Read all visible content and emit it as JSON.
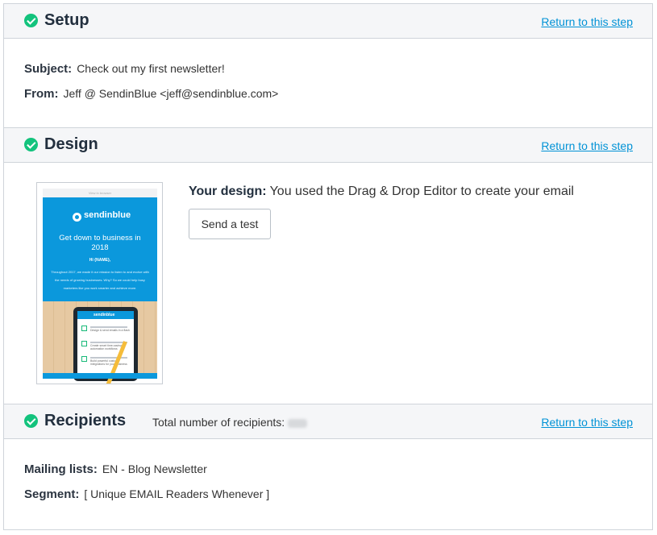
{
  "setup": {
    "title": "Setup",
    "return_link": "Return to this step",
    "subject_label": "Subject:",
    "subject_value": "Check out my first newsletter!",
    "from_label": "From:",
    "from_value": "Jeff @ SendinBlue <jeff@sendinblue.com>"
  },
  "design": {
    "title": "Design",
    "return_link": "Return to this step",
    "label": "Your design:",
    "description": "You used the Drag & Drop Editor to create your email",
    "send_test_label": "Send a test",
    "thumbnail": {
      "top_strip": "View in browser",
      "brand": "sendinblue",
      "headline": "Get down to business in 2018",
      "greeting": "Hi {NAME},",
      "body": "Throughout 2017, we made it our mission to listen to and evolve with the needs of growing businesses. Why? So we could help busy marketers like you work smarter and achieve more.",
      "pad_brand": "sendinblue",
      "pad_items": [
        "Design & send emails in a flash",
        "Create smart time-saving automation workflows",
        "Build powerful custom integrations for your business"
      ]
    }
  },
  "recipients": {
    "title": "Recipients",
    "total_label": "Total number of recipients:",
    "return_link": "Return to this step",
    "mailing_label": "Mailing lists:",
    "mailing_value": "EN - Blog Newsletter",
    "segment_label": "Segment:",
    "segment_value": "[ Unique EMAIL Readers Whenever ]"
  },
  "colors": {
    "check": "#13c37d",
    "link": "#0092d6",
    "header_bg": "#f5f6f8",
    "brand_blue": "#0b98dc"
  },
  "icons": {
    "step_complete": "check-circle-icon"
  }
}
